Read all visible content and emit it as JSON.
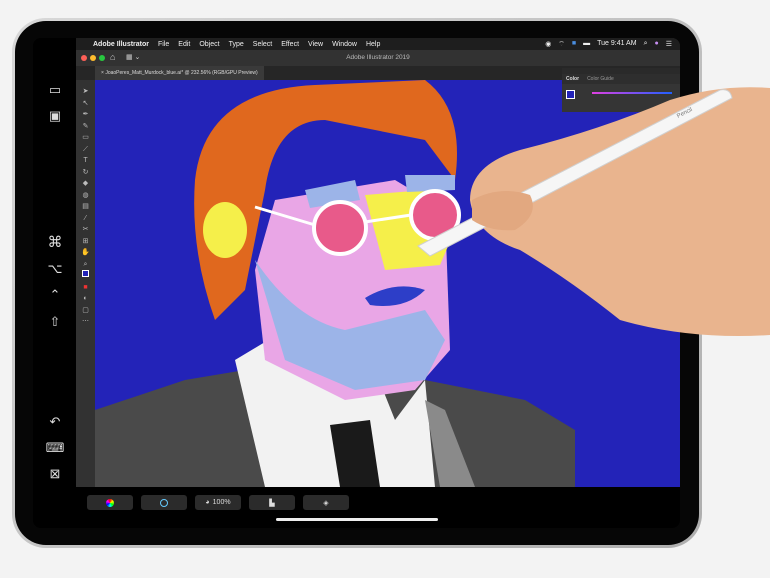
{
  "menubar": {
    "apple": "",
    "app": "Adobe Illustrator",
    "items": [
      "File",
      "Edit",
      "Object",
      "Type",
      "Select",
      "Effect",
      "View",
      "Window",
      "Help"
    ],
    "clock": "Tue 9:41 AM"
  },
  "window": {
    "title": "Adobe Illustrator 2019"
  },
  "document_tab": {
    "close": "×",
    "label": "JoaoPeres_Matt_Murdock_blue.ai* @ 232.56% (RGB/GPU Preview)"
  },
  "color_panel": {
    "tabs": [
      "Color",
      "Color Guide"
    ]
  },
  "touchbar": {
    "zoom": "100%"
  },
  "pencil": {
    "brand": "Pencil"
  },
  "colors": {
    "canvas": "#2323b8",
    "hair": "#e0681e",
    "skin": "#e9a6e6",
    "beard": "#9cb4e8",
    "suit": "#555555"
  },
  "sidecar_icons": [
    "menubar-toggle-icon",
    "dock-toggle-icon",
    "command-icon",
    "option-icon",
    "control-icon",
    "shift-icon",
    "undo-icon",
    "keyboard-icon",
    "disconnect-icon"
  ]
}
